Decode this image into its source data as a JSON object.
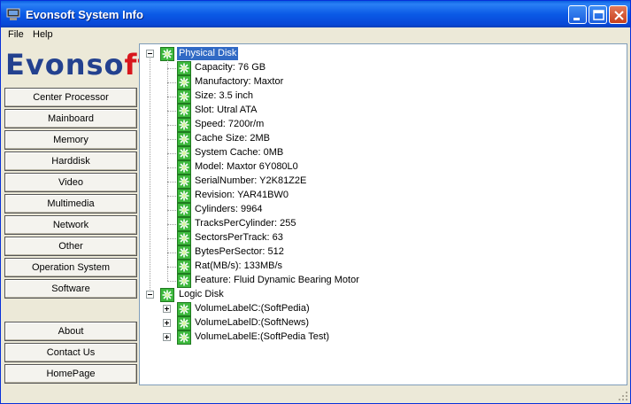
{
  "window": {
    "title": "Evonsoft System Info"
  },
  "menu": [
    "File",
    "Help"
  ],
  "logo": {
    "part1": "Evonso",
    "part2": "ft"
  },
  "nav": {
    "top": [
      "Center Processor",
      "Mainboard",
      "Memory",
      "Harddisk",
      "Video",
      "Multimedia",
      "Network",
      "Other",
      "Operation System",
      "Software"
    ],
    "bottom": [
      "About",
      "Contact Us",
      "HomePage"
    ]
  },
  "tree": {
    "physical_disk": {
      "label": "Physical Disk",
      "items": [
        "Capacity: 76 GB",
        "Manufactory: Maxtor",
        "Size: 3.5 inch",
        "Slot: Utral ATA",
        "Speed: 7200r/m",
        "Cache Size: 2MB",
        "System Cache: 0MB",
        "Model: Maxtor 6Y080L0",
        "SerialNumber: Y2K81Z2E",
        "Revision: YAR41BW0",
        "Cylinders: 9964",
        "TracksPerCylinder: 255",
        "SectorsPerTrack: 63",
        "BytesPerSector: 512",
        "Rat(MB/s): 133MB/s",
        "Feature: Fluid Dynamic Bearing Motor"
      ]
    },
    "logic_disk": {
      "label": "Logic Disk",
      "items": [
        "VolumeLabelC:(SoftPedia)",
        "VolumeLabelD:(SoftNews)",
        "VolumeLabelE:(SoftPedia Test)"
      ]
    }
  }
}
